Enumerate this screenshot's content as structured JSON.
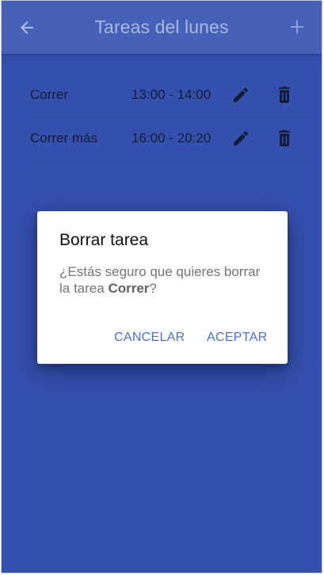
{
  "appbar": {
    "title": "Tareas del lunes",
    "back_icon": "arrow-back-icon",
    "add_icon": "plus-icon"
  },
  "tasks": [
    {
      "name": "Correr",
      "time": "13:00 - 14:00"
    },
    {
      "name": "Correr más",
      "time": "16:00 - 20:20"
    }
  ],
  "dialog": {
    "title": "Borrar tarea",
    "message_prefix": "¿Estás seguro que quieres borrar la tarea ",
    "task_name": "Correr",
    "message_suffix": "?",
    "cancel_label": "CANCELAR",
    "accept_label": "ACEPTAR"
  },
  "colors": {
    "background": "#3450ad",
    "appbar": "#4562b8",
    "accent": "#4a72d6"
  }
}
